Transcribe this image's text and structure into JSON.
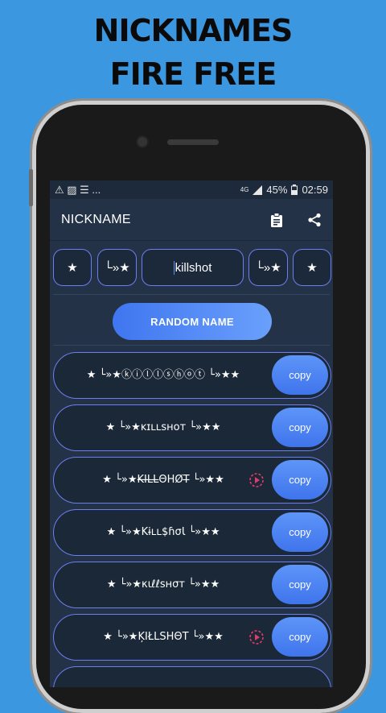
{
  "promo": {
    "line1": "NICKNAMES",
    "line2": "FIRE FREE"
  },
  "statusbar": {
    "network": "4G",
    "battery": "45%",
    "time": "02:59",
    "left_icons": "⚠ ▨ ☰ ..."
  },
  "appbar": {
    "title": "NICKNAME",
    "icons": [
      "clipboard-icon",
      "share-icon"
    ]
  },
  "symbols": {
    "left_outer": "★",
    "left_inner": "└»★",
    "input_value": "killshot",
    "right_inner": "└»★",
    "right_outer": "★"
  },
  "random_button": "RANDOM NAME",
  "results": [
    {
      "text": "★ └»★ⓚⓘⓛⓛⓢⓗⓞⓣ └»★★",
      "copy": "copy",
      "ad": false
    },
    {
      "text": "★ └»★ᴋɪʟʟsʜᴏᴛ └»★★",
      "copy": "copy",
      "ad": false
    },
    {
      "text": "★ └»★K̶I̶L̶L̶ΘHØT̶ └»★★",
      "copy": "copy",
      "ad": true
    },
    {
      "text": "★ └»★Kɨʟʟ$ɦσƖ └»★★",
      "copy": "copy",
      "ad": false
    },
    {
      "text": "★ └»★κιℓℓѕнσт └»★★",
      "copy": "copy",
      "ad": false
    },
    {
      "text": "★ └»★ĶIŁLSHΘT └»★★",
      "copy": "copy",
      "ad": true
    },
    {
      "text": "",
      "copy": "",
      "ad": false
    }
  ],
  "colors": {
    "background": "#3b97e0",
    "screen": "#243247",
    "accent": "#6b7ff0",
    "button": "#4a82f4",
    "ad_icon": "#e23b6a"
  }
}
